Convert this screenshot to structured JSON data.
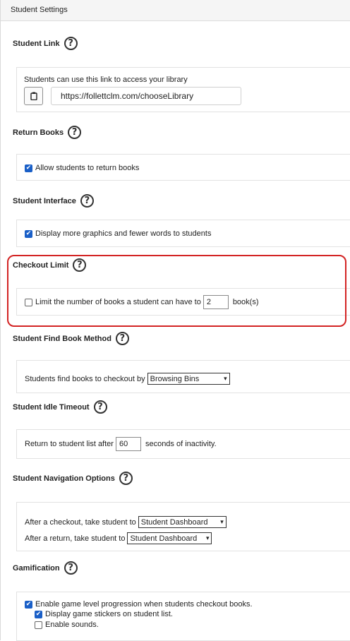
{
  "header": {
    "title": "Student Settings"
  },
  "student_link": {
    "title": "Student Link",
    "description": "Students can use this link to access your library",
    "url": "https://follettclm.com/chooseLibrary"
  },
  "return_books": {
    "title": "Return Books",
    "option_label": "Allow students to return books",
    "checked": true
  },
  "student_interface": {
    "title": "Student Interface",
    "option_label": "Display more graphics and fewer words to students",
    "checked": true
  },
  "checkout_limit": {
    "title": "Checkout Limit",
    "option_label": "Limit the number of books a student can have to",
    "value": "2",
    "suffix": "book(s)",
    "checked": false
  },
  "find_book_method": {
    "title": "Student Find Book Method",
    "label": "Students find books to checkout by",
    "selected": "Browsing Bins"
  },
  "idle_timeout": {
    "title": "Student Idle Timeout",
    "label_before": "Return to student list after",
    "value": "60",
    "label_after": "seconds of inactivity."
  },
  "navigation_options": {
    "title": "Student Navigation Options",
    "checkout_label": "After a checkout, take student to",
    "checkout_selected": "Student Dashboard",
    "return_label": "After a return, take student to",
    "return_selected": "Student Dashboard"
  },
  "gamification": {
    "title": "Gamification",
    "level_label": "Enable game level progression when students checkout books.",
    "level_checked": true,
    "stickers_label": "Display game stickers on student list.",
    "stickers_checked": true,
    "sounds_label": "Enable sounds.",
    "sounds_checked": false
  },
  "icons": {
    "help": "help-circle-icon",
    "copy": "clipboard-icon",
    "dropdown": "chevron-down-icon"
  },
  "colors": {
    "highlight": "#d32424",
    "checkbox": "#1a5fc7",
    "header_bg": "#f5f5f5"
  }
}
